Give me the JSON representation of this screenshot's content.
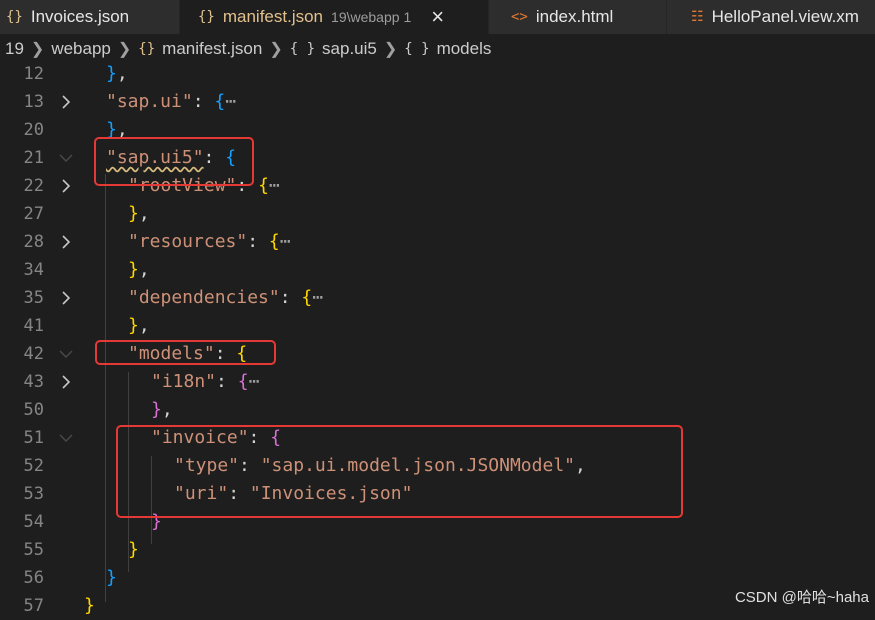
{
  "tabs": [
    {
      "label": "Invoices.json",
      "icon": "json-braces-icon"
    },
    {
      "label": "manifest.json",
      "description": "19\\webapp",
      "badge": "1",
      "icon": "json-braces-icon",
      "active": true
    },
    {
      "label": "index.html",
      "icon": "html-code-icon"
    },
    {
      "label": "HelloPanel.view.xm",
      "icon": "xml-rss-icon"
    }
  ],
  "breadcrumb": [
    "19",
    "webapp",
    "manifest.json",
    "sap.ui5",
    "models"
  ],
  "lines": [
    {
      "n": "12",
      "text": "},"
    },
    {
      "n": "13",
      "key": "\"sap.ui\"",
      "collapsed": true
    },
    {
      "n": "20",
      "text": "},"
    },
    {
      "n": "21",
      "key": "\"sap.ui5\"",
      "open": true
    },
    {
      "n": "22",
      "key": "\"rootView\"",
      "collapsed": true
    },
    {
      "n": "27",
      "text": "},"
    },
    {
      "n": "28",
      "key": "\"resources\"",
      "collapsed": true
    },
    {
      "n": "34",
      "text": "},"
    },
    {
      "n": "35",
      "key": "\"dependencies\"",
      "collapsed": true
    },
    {
      "n": "41",
      "text": "},"
    },
    {
      "n": "42",
      "key": "\"models\"",
      "open": true
    },
    {
      "n": "43",
      "key": "\"i18n\"",
      "collapsed": true
    },
    {
      "n": "50",
      "text": "},"
    },
    {
      "n": "51",
      "key": "\"invoice\"",
      "open": true
    },
    {
      "n": "52",
      "key": "\"type\"",
      "value": "\"sap.ui.model.json.JSONModel\""
    },
    {
      "n": "53",
      "key": "\"uri\"",
      "value": "\"Invoices.json\""
    },
    {
      "n": "54",
      "text": "}"
    },
    {
      "n": "55",
      "text": "}"
    },
    {
      "n": "56",
      "text": "}"
    },
    {
      "n": "57",
      "text": "}"
    }
  ],
  "code": {
    "colon": ": ",
    "comma": ",",
    "ellipsis": "⋯",
    "open_brace": "{",
    "close_brace": "}",
    "close_brace_comma": "},"
  },
  "watermark": "CSDN @哈哈~haha",
  "colors": {
    "highlight_box": "#e53935",
    "json_icon": "#e2c08d",
    "bracket_level1": "#da70d6",
    "bracket_level2": "#179fff",
    "bracket_level3": "#ffd700"
  }
}
